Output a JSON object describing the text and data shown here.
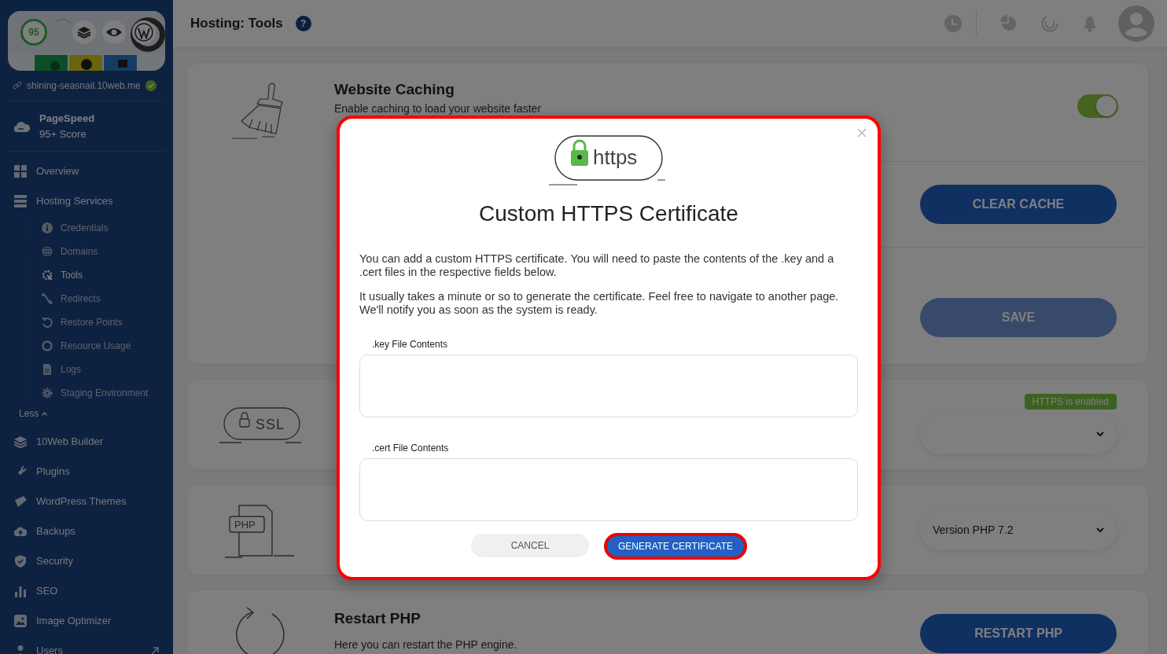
{
  "sidebar": {
    "site": {
      "score": "95",
      "url": "shining-seasnail.10web.me",
      "verified": true
    },
    "pagespeed": {
      "title": "PageSpeed",
      "subtitle": "95+ Score"
    },
    "items": [
      {
        "label": "Overview",
        "selected": false
      },
      {
        "label": "Hosting Services",
        "selected": false,
        "expanded": true,
        "children": [
          {
            "label": "Credentials",
            "selected": false
          },
          {
            "label": "Domains",
            "selected": false
          },
          {
            "label": "Tools",
            "selected": true
          },
          {
            "label": "Redirects",
            "selected": false
          },
          {
            "label": "Restore Points",
            "selected": false
          },
          {
            "label": "Resource Usage",
            "selected": false
          },
          {
            "label": "Logs",
            "selected": false
          },
          {
            "label": "Staging Environment",
            "selected": false
          }
        ],
        "collapse_label": "Less"
      },
      {
        "label": "10Web Builder",
        "selected": false
      },
      {
        "label": "Plugins",
        "selected": false
      },
      {
        "label": "WordPress Themes",
        "selected": false
      },
      {
        "label": "Backups",
        "selected": false
      },
      {
        "label": "Security",
        "selected": false
      },
      {
        "label": "SEO",
        "selected": false
      },
      {
        "label": "Image Optimizer",
        "selected": false
      },
      {
        "label": "Users",
        "selected": false,
        "external": true
      }
    ]
  },
  "header": {
    "title": "Hosting: Tools",
    "help": "?"
  },
  "caching": {
    "title": "Website Caching",
    "description": "Enable caching to load your website faster",
    "on": true,
    "clear_button": "CLEAR CACHE",
    "save_button": "SAVE",
    "save_disabled": true
  },
  "ssl": {
    "drawing_text": "SSL",
    "status": "HTTPS is enabled"
  },
  "php": {
    "drawing_text": "PHP",
    "version": "Version PHP 7.2"
  },
  "restart": {
    "title": "Restart PHP",
    "description": "Here you can restart the PHP engine.",
    "button": "RESTART PHP"
  },
  "modal": {
    "logo_text": "https",
    "title": "Custom HTTPS Certificate",
    "paragraphs": [
      "You can add a custom HTTPS certificate. You will need to paste the contents of the .key and a .cert files in the respective fields below.",
      "It usually takes a minute or so to generate the certificate. Feel free to navigate to another page. We'll notify you as soon as the system is ready."
    ],
    "fields": [
      {
        "label": ".key File Contents"
      },
      {
        "label": ".cert File Contents"
      }
    ],
    "cancel": "CANCEL",
    "submit": "GENERATE CERTIFICATE"
  }
}
